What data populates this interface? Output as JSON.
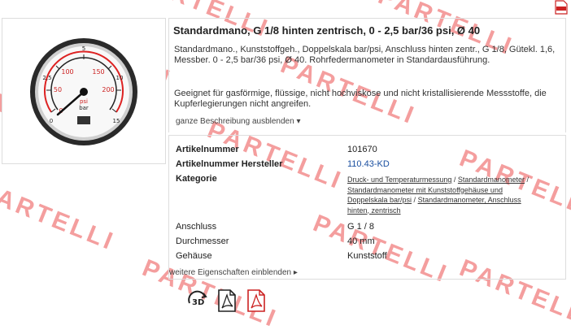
{
  "product": {
    "title": "Standardmano, G 1/8 hinten zentrisch, 0 - 2,5 bar/36 psi, Ø 40",
    "desc1": "Standardmano., Kunststoffgeh., Doppelskala bar/psi, Anschluss hinten zentr., G 1/8, Gütekl. 1,6, Messber. 0 - 2,5 bar/36 psi, Ø 40. Rohrfedermanometer in Standardausführung.",
    "desc2": "Geeignet für gasförmige, flüssige, nicht hochviskose und nicht kristallisierende Messstoffe, die Kupferlegierungen nicht angreifen.",
    "toggle": "ganze Beschreibung ausblenden"
  },
  "props": {
    "art_label": "Artikelnummer",
    "art_value": "101670",
    "mfr_label": "Artikelnummer Hersteller",
    "mfr_value": "110.43-KD",
    "cat_label": "Kategorie",
    "cat_links": [
      "Druck- und Temperaturmessung",
      "Standardmanometer",
      "Standardmanometer mit Kunststoffgehäuse und Doppelskala bar/psi",
      "Standardmanometer, Anschluss hinten, zentrisch"
    ],
    "conn_label": "Anschluss",
    "conn_value": "G 1 / 8",
    "dia_label": "Durchmesser",
    "dia_value": "40 mm",
    "housing_label": "Gehäuse",
    "housing_value": "Kunststoff",
    "more": "weitere Eigenschaften einblenden"
  },
  "gauge": {
    "outer_scale": [
      "0",
      "50",
      "100",
      "150",
      "200",
      "250",
      "300"
    ],
    "inner_scale": [
      "0",
      "2,5",
      "5",
      "10",
      "15"
    ],
    "unit_psi": "psi",
    "unit_bar": "bar"
  },
  "icons": [
    "3d-icon",
    "pdf-icon",
    "pdf-icon-red"
  ],
  "watermark": "PARTELLI",
  "colors": {
    "watermark": "#e62828",
    "link": "#1a4fa0"
  }
}
